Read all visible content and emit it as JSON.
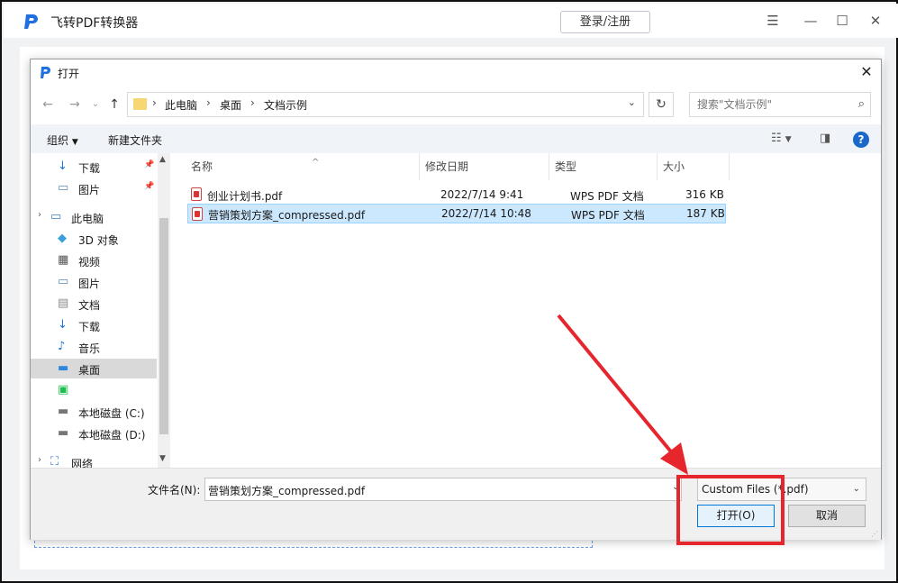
{
  "app": {
    "name": "飞转PDF转换器",
    "login_label": "登录/注册",
    "menu_icon": "hamburger-icon",
    "minimize_icon": "minimize-icon",
    "maximize_icon": "maximize-icon",
    "close_icon": "close-icon"
  },
  "dialog": {
    "title": "打开",
    "breadcrumb": [
      "此电脑",
      "桌面",
      "文档示例"
    ],
    "search_placeholder": "搜索\"文档示例\"",
    "toolbar": {
      "organize": "组织",
      "new_folder": "新建文件夹"
    },
    "nav": [
      {
        "label": "下载",
        "icon": "download-icon",
        "pinned": true
      },
      {
        "label": "图片",
        "icon": "pictures-icon",
        "pinned": true
      },
      {
        "label": "此电脑",
        "icon": "computer-icon"
      },
      {
        "label": "3D 对象",
        "icon": "3d-objects-icon"
      },
      {
        "label": "视频",
        "icon": "videos-icon"
      },
      {
        "label": "图片",
        "icon": "pictures-icon"
      },
      {
        "label": "文档",
        "icon": "documents-icon"
      },
      {
        "label": "下载",
        "icon": "download-icon"
      },
      {
        "label": "音乐",
        "icon": "music-icon"
      },
      {
        "label": "桌面",
        "icon": "desktop-icon",
        "selected": true
      },
      {
        "label": "",
        "icon": "iqiyi-icon"
      },
      {
        "label": "本地磁盘 (C:)",
        "icon": "drive-icon"
      },
      {
        "label": "本地磁盘 (D:)",
        "icon": "drive-icon"
      },
      {
        "label": "网络",
        "icon": "network-icon"
      }
    ],
    "columns": {
      "name": "名称",
      "date": "修改日期",
      "type": "类型",
      "size": "大小"
    },
    "files": [
      {
        "name": "创业计划书.pdf",
        "date": "2022/7/14 9:41",
        "type": "WPS PDF 文档",
        "size": "316 KB"
      },
      {
        "name": "营销策划方案_compressed.pdf",
        "date": "2022/7/14 10:48",
        "type": "WPS PDF 文档",
        "size": "187 KB",
        "selected": true
      }
    ],
    "filename_label": "文件名(N):",
    "filename_value": "营销策划方案_compressed.pdf",
    "filetype": "Custom Files (*.pdf)",
    "open_label": "打开(O)",
    "cancel_label": "取消"
  },
  "colors": {
    "accent": "#0078d7",
    "selection": "#cce8ff",
    "annotation": "#e5262d"
  }
}
